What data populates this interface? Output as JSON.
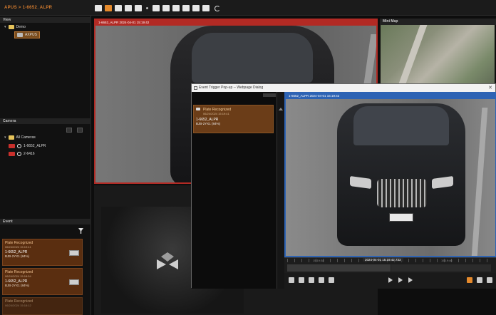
{
  "app": {
    "title": "APUS > 1-6652_ALPR"
  },
  "panels": {
    "view": "View",
    "cameras": "Camera",
    "event": "Event",
    "mini_map": "Mini Map"
  },
  "view_tree": {
    "root": "Demo",
    "child": "AXPUS"
  },
  "camera_tree": {
    "root": "All Cameras",
    "items": [
      "1-6652_ALPR",
      "2-6416"
    ]
  },
  "events": [
    {
      "type": "Plate Recognized",
      "time": "06/24/2024 15:19:41",
      "camera": "1-6652_ALPR",
      "plate": "BJB-2YX1 (84%)"
    },
    {
      "type": "Plate Recognized",
      "time": "06/24/2024 15:18:54",
      "camera": "1-6652_ALPR",
      "plate": "BJB-2YX1 (84%)"
    },
    {
      "type": "Plate Recognized",
      "time": "06/24/2024 15:18:12",
      "camera": "",
      "plate": ""
    }
  ],
  "main_video": {
    "title": "1-6652_ALPR   2024-04-01 15:19:42"
  },
  "popup": {
    "title": "Event Trigger Pop-up -- Webpage Dialog",
    "close": "✕",
    "card": {
      "type": "Plate Recognized",
      "time": "06/24/2024 15:19:41",
      "camera": "1-6652_ALPR",
      "plate": "BJB-2YX1 (84%)"
    },
    "video_title": "1-6652_ALPR   2024-04-01 15:19:42",
    "timeline_time": "2024-04-01 15:19:42.733",
    "timeline_labels": [
      "15:19:38",
      "15:19:42",
      "15:19:46"
    ]
  },
  "colors": {
    "accent_orange": "#e58a2c",
    "event_brown": "#5a2e10",
    "main_border": "#b22a24",
    "popup_border": "#2d63b4"
  }
}
